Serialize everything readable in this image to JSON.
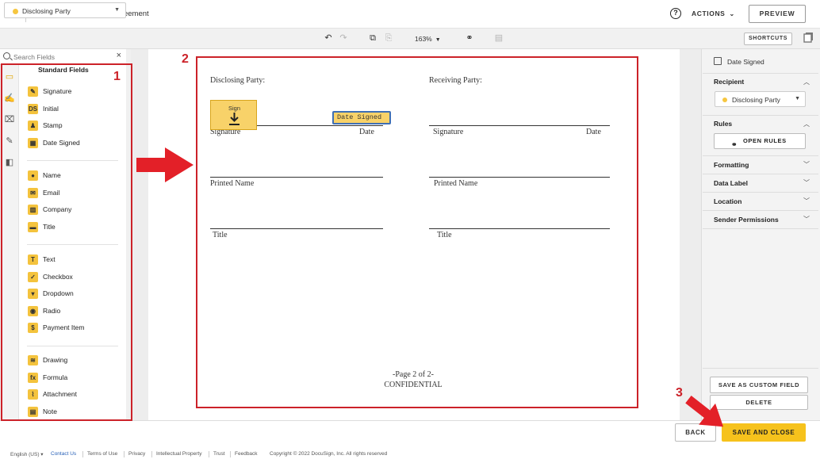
{
  "header": {
    "close_glyph": "✕",
    "document_title": "Mutual Non-Disclosure Agreement",
    "help_glyph": "?",
    "actions_label": "ACTIONS",
    "preview_label": "PREVIEW"
  },
  "toolbar": {
    "recipient": "Disclosing Party",
    "zoom": "163%",
    "shortcuts_label": "SHORTCUTS"
  },
  "sidebar": {
    "search_placeholder": "Search Fields",
    "header": "Standard Fields",
    "groups": [
      [
        {
          "label": "Signature",
          "icon": "pen-icon",
          "glyph": "✎"
        },
        {
          "label": "Initial",
          "icon": "initial-icon",
          "glyph": "DS"
        },
        {
          "label": "Stamp",
          "icon": "stamp-icon",
          "glyph": "♟"
        },
        {
          "label": "Date Signed",
          "icon": "calendar-icon",
          "glyph": "▦"
        }
      ],
      [
        {
          "label": "Name",
          "icon": "person-icon",
          "glyph": "●"
        },
        {
          "label": "Email",
          "icon": "envelope-icon",
          "glyph": "✉"
        },
        {
          "label": "Company",
          "icon": "building-icon",
          "glyph": "▥"
        },
        {
          "label": "Title",
          "icon": "briefcase-icon",
          "glyph": "▬"
        }
      ],
      [
        {
          "label": "Text",
          "icon": "text-icon",
          "glyph": "T"
        },
        {
          "label": "Checkbox",
          "icon": "checkbox-icon",
          "glyph": "✓"
        },
        {
          "label": "Dropdown",
          "icon": "dropdown-icon",
          "glyph": "▾"
        },
        {
          "label": "Radio",
          "icon": "radio-icon",
          "glyph": "◉"
        },
        {
          "label": "Payment Item",
          "icon": "payment-icon",
          "glyph": "$"
        }
      ],
      [
        {
          "label": "Drawing",
          "icon": "drawing-icon",
          "glyph": "≋"
        },
        {
          "label": "Formula",
          "icon": "formula-icon",
          "glyph": "fx"
        },
        {
          "label": "Attachment",
          "icon": "paperclip-icon",
          "glyph": "⌇"
        },
        {
          "label": "Note",
          "icon": "note-icon",
          "glyph": "▤"
        }
      ]
    ]
  },
  "document": {
    "disclosing_party": "Disclosing Party:",
    "receiving_party": "Receiving Party:",
    "signature": "Signature",
    "date": "Date",
    "printed_name": "Printed Name",
    "title": "Title",
    "page_indicator": "-Page 2 of 2-",
    "confidential": "CONFIDENTIAL",
    "sign_tag_label": "Sign",
    "date_tag_label": "Date Signed"
  },
  "right_panel": {
    "field_title": "Date Signed",
    "recipient_label": "Recipient",
    "recipient_value": "Disclosing Party",
    "rules_label": "Rules",
    "open_rules_label": "OPEN RULES",
    "formatting_label": "Formatting",
    "data_label_label": "Data Label",
    "location_label": "Location",
    "sender_permissions_label": "Sender Permissions",
    "save_custom_label": "SAVE AS CUSTOM FIELD",
    "delete_label": "DELETE"
  },
  "actions": {
    "back_label": "BACK",
    "save_close_label": "SAVE AND CLOSE"
  },
  "footer": {
    "language": "English (US) ▾",
    "contact": "Contact Us",
    "terms": "Terms of Use",
    "privacy": "Privacy",
    "ip": "Intellectual Property",
    "trust": "Trust",
    "feedback": "Feedback",
    "copyright": "Copyright © 2022 DocuSign, Inc. All rights reserved"
  },
  "callouts": {
    "one": "1",
    "two": "2",
    "three": "3"
  },
  "colors": {
    "accent": "#f6c21c",
    "callout": "#cc2229",
    "field_tag": "#f8d269",
    "selection": "#3e6fb5"
  }
}
